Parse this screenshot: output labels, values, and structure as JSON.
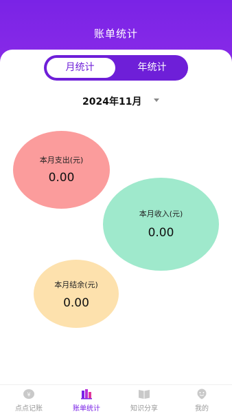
{
  "header": {
    "title": "账单统计"
  },
  "segment": {
    "month_label": "月统计",
    "year_label": "年统计",
    "selected": "month"
  },
  "date_picker": {
    "value": "2024年11月"
  },
  "summary": {
    "expense": {
      "label": "本月支出(元)",
      "value": "0.00",
      "color": "#fb9c9c"
    },
    "income": {
      "label": "本月收入(元)",
      "value": "0.00",
      "color": "#9fe9cc"
    },
    "balance": {
      "label": "本月结余(元)",
      "value": "0.00",
      "color": "#fde1ad"
    }
  },
  "tabbar": {
    "items": [
      {
        "label": "点点记账",
        "icon": "coin-icon"
      },
      {
        "label": "账单统计",
        "icon": "bar-chart-icon"
      },
      {
        "label": "知识分享",
        "icon": "book-icon"
      },
      {
        "label": "我的",
        "icon": "profile-icon"
      }
    ],
    "active_index": 1
  },
  "colors": {
    "accent": "#7a23e6",
    "inactive": "#9a9a9a"
  }
}
